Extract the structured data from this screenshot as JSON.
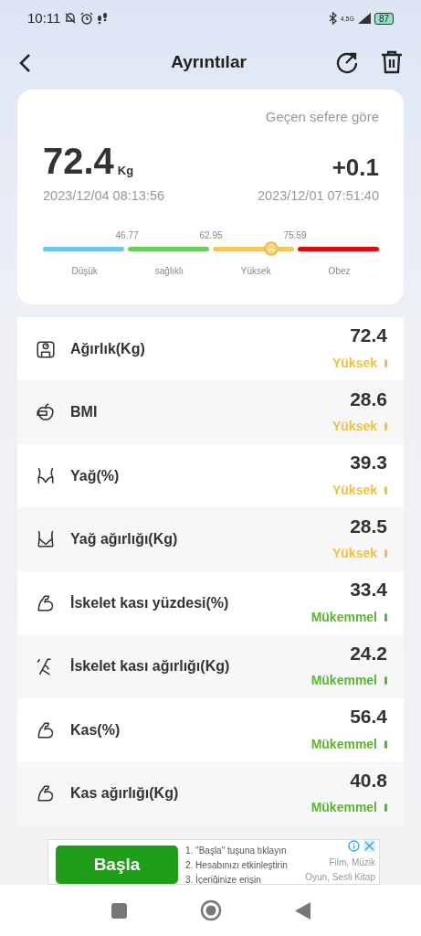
{
  "status_bar": {
    "time": "10:11",
    "network": "4.5G",
    "battery": "87"
  },
  "header": {
    "title": "Ayrıntılar"
  },
  "summary": {
    "compare_label": "Geçen sefere göre",
    "value": "72.4",
    "unit": "Kg",
    "date": "2023/12/04 08:13:56",
    "delta": "+0.1",
    "previous_date": "2023/12/01 07:51:40",
    "scale": {
      "level": 0.68,
      "thresholds": [
        "46.77",
        "62.95",
        "75.59"
      ],
      "segments": [
        {
          "label": "Düşük",
          "color": "#6ec6e8"
        },
        {
          "label": "sağlıklı",
          "color": "#6acb5f"
        },
        {
          "label": "Yüksek",
          "color": "#f0c75a"
        },
        {
          "label": "Obez",
          "color": "#d90f0f"
        }
      ]
    }
  },
  "metrics": [
    {
      "kind": "scale",
      "label": "Ağırlık(Kg)",
      "value": "72.4",
      "status": "Yüksek",
      "color": "#f0c040"
    },
    {
      "kind": "apple",
      "label": "BMI",
      "value": "28.6",
      "status": "Yüksek",
      "color": "#f0c040"
    },
    {
      "kind": "waist",
      "label": "Yağ(%)",
      "value": "39.3",
      "status": "Yüksek",
      "color": "#f0c040"
    },
    {
      "kind": "hips",
      "label": "Yağ ağırlığı(Kg)",
      "value": "28.5",
      "status": "Yüksek",
      "color": "#f0c040"
    },
    {
      "kind": "arm",
      "label": "İskelet kası yüzdesi(%)",
      "value": "33.4",
      "status": "Mükemmel",
      "color": "#5cb531"
    },
    {
      "kind": "bone",
      "label": "İskelet kası ağırlığı(Kg)",
      "value": "24.2",
      "status": "Mükemmel",
      "color": "#5cb531"
    },
    {
      "kind": "arm",
      "label": "Kas(%)",
      "value": "56.4",
      "status": "Mükemmel",
      "color": "#5cb531"
    },
    {
      "kind": "arm",
      "label": "Kas ağırlığı(Kg)",
      "value": "40.8",
      "status": "Mükemmel",
      "color": "#5cb531"
    }
  ],
  "ad": {
    "button": "Başla",
    "steps": [
      "1. \"Başla\" tuşuna tıklayın",
      "2. Hesabınızı etkinleştirin",
      "3. İçeriğinize erişin"
    ],
    "side": [
      "Film, Müzik",
      "Oyun, Sesli Kitap"
    ]
  }
}
